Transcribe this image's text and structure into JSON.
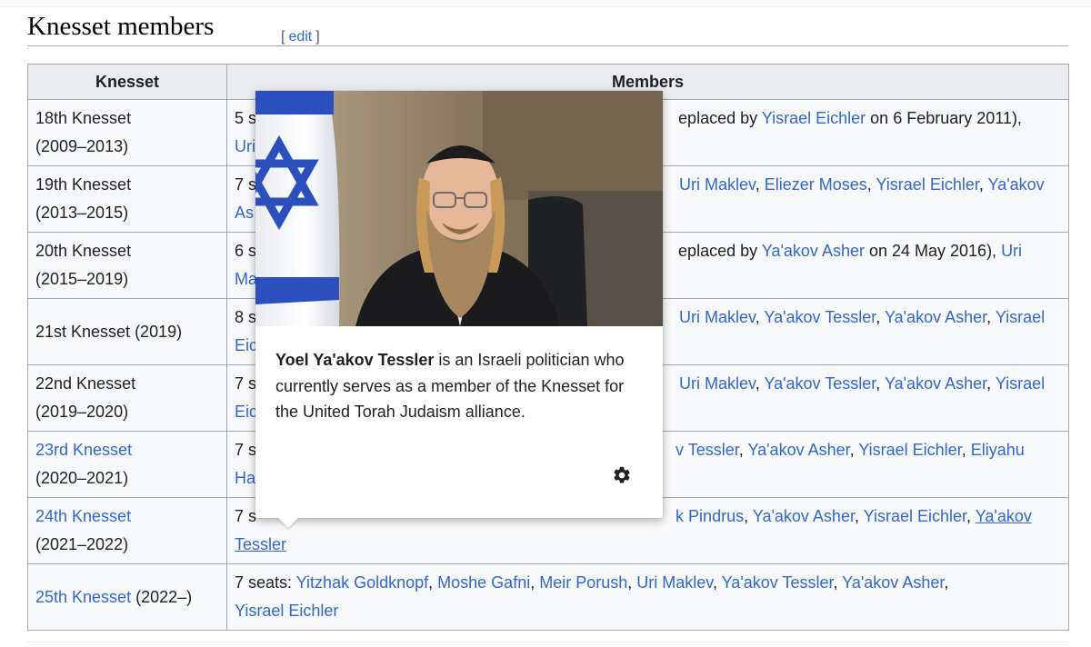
{
  "section": {
    "title": "Knesset members",
    "edit_open": "[",
    "edit_label": "edit",
    "edit_close": "]"
  },
  "table": {
    "headers": [
      "Knesset",
      "Members"
    ],
    "rows": [
      {
        "knesset": "18th Knesset",
        "period": "(2009–2013)",
        "members_line1_start": "5 s",
        "members_line1_end_text": "eplaced by ",
        "members_line1_link": "Yisrael Eichler",
        "members_line1_tail": " on 6 February 2011),",
        "members_line2": "Uri"
      },
      {
        "knesset": "19th Knesset",
        "period": "(2013–2015)",
        "members_line1_start": "7 s",
        "links": [
          "Uri Maklev",
          "Eliezer Moses",
          "Yisrael Eichler",
          "Ya'akov"
        ],
        "members_line2": "As"
      },
      {
        "knesset": "20th Knesset",
        "period": "(2015–2019)",
        "members_line1_start": "6 s",
        "members_line1_end_text": "eplaced by ",
        "members_line1_link": "Ya'akov Asher",
        "members_line1_tail": " on 24 May 2016), ",
        "members_line1_link2": "Uri",
        "members_line2": "Ma"
      },
      {
        "knesset": "21st Knesset (2019)",
        "members_line1_start": "8 s",
        "links": [
          "Uri Maklev",
          "Ya'akov Tessler",
          "Ya'akov Asher",
          "Yisrael"
        ],
        "members_line2": "Eic"
      },
      {
        "knesset": "22nd Knesset",
        "period": "(2019–2020)",
        "members_line1_start": "7 s",
        "links": [
          "Uri Maklev",
          "Ya'akov Tessler",
          "Ya'akov Asher",
          "Yisrael"
        ],
        "members_line2": "Eic"
      },
      {
        "knesset": "23rd Knesset",
        "period": "(2020–2021)",
        "members_line1_start": "7 s",
        "links": [
          "v Tessler",
          "Ya'akov Asher",
          "Yisrael Eichler",
          "Eliyahu"
        ],
        "members_line2": "Ha"
      },
      {
        "knesset": "24th Knesset",
        "period": "(2021–2022)",
        "members_line1_start": "7 s",
        "links": [
          "k Pindrus",
          "Ya'akov Asher",
          "Yisrael Eichler",
          "Ya'akov"
        ],
        "members_line2": "Tessler"
      },
      {
        "knesset": "25th Knesset",
        "period": "(2022–)",
        "members_prefix": "7 seats: ",
        "links": [
          "Yitzhak Goldknopf",
          "Moshe Gafni",
          "Meir Porush",
          "Uri Maklev",
          "Ya'akov Tessler",
          "Ya'akov Asher"
        ],
        "members_line2": "Yisrael Eichler"
      }
    ]
  },
  "popup": {
    "name": "Yoel Ya'akov Tessler",
    "text": " is an Israeli politician who currently serves as a member of the Knesset for the United Torah Judaism alliance.",
    "settings_icon": "gear-icon"
  },
  "colors": {
    "link": "#3366cc",
    "header_bg": "#eaecf0",
    "cell_bg": "#f8f9fa",
    "border": "#a2a9b1"
  }
}
